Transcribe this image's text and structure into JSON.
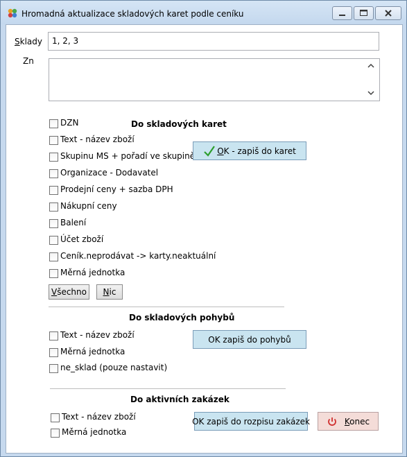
{
  "window": {
    "title": "Hromadná aktualizace skladových karet podle ceníku",
    "icon": "clover-app-icon"
  },
  "sklady": {
    "label_first": "S",
    "label_rest": "klady",
    "value": "1, 2, 3"
  },
  "zn": {
    "label": "Zn",
    "value": ""
  },
  "karet_section": {
    "heading": "Do skladových karet",
    "items": [
      {
        "label": "DZN",
        "checked": false
      },
      {
        "label": "Text - název zboží",
        "checked": false
      },
      {
        "label": "Skupinu MS + pořadí ve skupině",
        "checked": false
      },
      {
        "label": "Organizace - Dodavatel",
        "checked": false
      },
      {
        "label": "Prodejní ceny + sazba DPH",
        "checked": false
      },
      {
        "label": "Nákupní ceny",
        "checked": false
      },
      {
        "label": "Balení",
        "checked": false
      },
      {
        "label": "Účet zboží",
        "checked": false
      },
      {
        "label": "Ceník.neprodávat -> karty.neaktuální",
        "checked": false
      },
      {
        "label": "Měrná jednotka",
        "checked": false
      }
    ],
    "ok_button": {
      "mn": "O",
      "rest": "K - zapiš do karet"
    },
    "all_button": {
      "mn": "V",
      "rest": "šechno"
    },
    "none_button": {
      "mn": "N",
      "rest": "ic"
    }
  },
  "pohybu_section": {
    "heading": "Do skladových pohybů",
    "items": [
      {
        "label": "Text - název zboží",
        "checked": false
      },
      {
        "label": "Měrná jednotka",
        "checked": false
      },
      {
        "label": "ne_sklad (pouze nastavit)",
        "checked": false
      }
    ],
    "ok_button": "OK zapiš do pohybů"
  },
  "zakazek_section": {
    "heading": "Do aktivních zakázek",
    "items": [
      {
        "label": "Text - název zboží",
        "checked": false
      },
      {
        "label": "Měrná jednotka",
        "checked": false
      }
    ],
    "ok_button": "OK zapiš do rozpisu zakázek"
  },
  "close_button": {
    "mn": "K",
    "rest": "onec"
  },
  "colors": {
    "accent_check": "#2e9e2e",
    "close_icon": "#d03030",
    "button_bg": "#c9e4f0"
  }
}
